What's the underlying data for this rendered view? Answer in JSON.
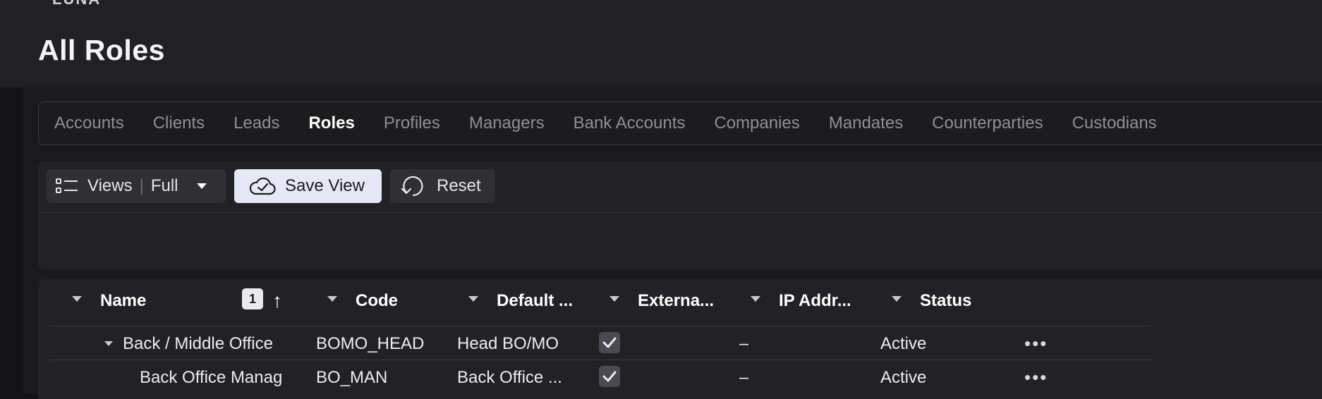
{
  "header": {
    "crumb": "LUNA",
    "title": "All Roles"
  },
  "tabs": [
    {
      "label": "Accounts"
    },
    {
      "label": "Clients"
    },
    {
      "label": "Leads"
    },
    {
      "label": "Roles",
      "active": true
    },
    {
      "label": "Profiles"
    },
    {
      "label": "Managers"
    },
    {
      "label": "Bank Accounts"
    },
    {
      "label": "Companies"
    },
    {
      "label": "Mandates"
    },
    {
      "label": "Counterparties"
    },
    {
      "label": "Custodians"
    }
  ],
  "toolbar": {
    "views_label": "Views",
    "views_value": "Full",
    "save_label": "Save View",
    "reset_label": "Reset"
  },
  "grid": {
    "sort_index": "1",
    "sort_direction_glyph": "↑",
    "columns": [
      {
        "label": "Name"
      },
      {
        "label": "Code"
      },
      {
        "label": "Default ..."
      },
      {
        "label": "Externa..."
      },
      {
        "label": "IP Addr..."
      },
      {
        "label": "Status"
      }
    ],
    "rows": [
      {
        "name": "Back / Middle Office",
        "code": "BOMO_HEAD",
        "default": "Head BO/MO",
        "external_checked": true,
        "ip": "–",
        "status": "Active",
        "actions": "•••"
      },
      {
        "name": "Back Office Manag",
        "code": "BO_MAN",
        "default": "Back Office ...",
        "external_checked": true,
        "ip": "–",
        "status": "Active",
        "actions": "•••"
      }
    ]
  },
  "colors": {
    "accent_button_bg": "#e6e8f5",
    "panel_bg": "#222226",
    "page_bg": "#141416"
  },
  "icons": {
    "views": "list-icon",
    "save": "cloud-check-icon",
    "reset": "undo-icon",
    "dropdown": "caret-down-icon",
    "checkbox": "checkmark-icon"
  }
}
